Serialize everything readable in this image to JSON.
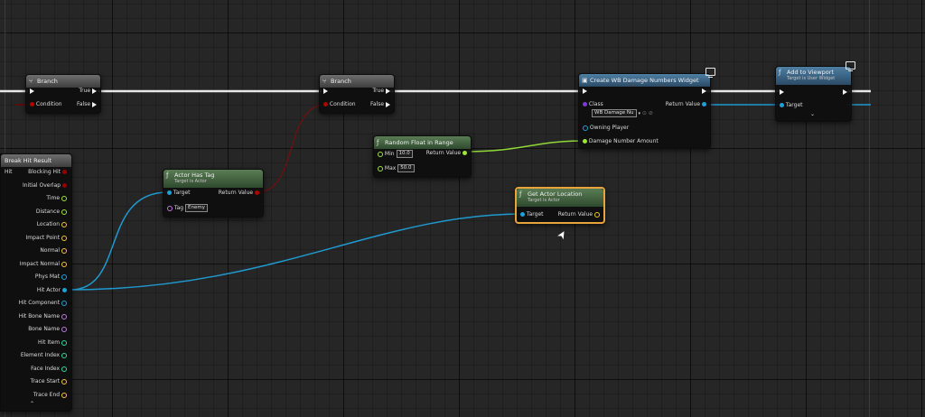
{
  "colors": {
    "exec": "#f0f0f0",
    "bool": "#930000",
    "object": "#1fa0d8",
    "float": "#9ee43c",
    "vector": "#f5c434",
    "struct": "#3a8fd0",
    "name": "#c07ad9",
    "int": "#2fd6a0",
    "selected": "#e8a33a"
  },
  "branch1": {
    "title": "Branch",
    "true_label": "True",
    "false_label": "False",
    "condition_label": "Condition"
  },
  "branch2": {
    "title": "Branch",
    "true_label": "True",
    "false_label": "False",
    "condition_label": "Condition"
  },
  "create_widget": {
    "title": "Create WB Damage Numbers Widget",
    "class_label": "Class",
    "class_value": "WB Damage Nu",
    "return_label": "Return Value",
    "owning_player_label": "Owning Player",
    "damage_amount_label": "Damage Number Amount"
  },
  "add_to_viewport": {
    "title": "Add to Viewport",
    "subtitle": "Target is User Widget",
    "target_label": "Target"
  },
  "random_float": {
    "title": "Random Float in Range",
    "min_label": "Min",
    "min_value": "10.0",
    "max_label": "Max",
    "max_value": "50.0",
    "return_label": "Return Value"
  },
  "actor_has_tag": {
    "title": "Actor Has Tag",
    "subtitle": "Target is Actor",
    "target_label": "Target",
    "return_label": "Return Value",
    "tag_label": "Tag",
    "tag_value": "Enemy"
  },
  "get_actor_location": {
    "title": "Get Actor Location",
    "subtitle": "Target is Actor",
    "target_label": "Target",
    "return_label": "Return Value"
  },
  "break_hit": {
    "title": "Break Hit Result",
    "hit_label": "Hit",
    "pins": [
      "Blocking Hit",
      "Initial Overlap",
      "Time",
      "Distance",
      "Location",
      "Impact Point",
      "Normal",
      "Impact Normal",
      "Phys Mat",
      "Hit Actor",
      "Hit Component",
      "Hit Bone Name",
      "Bone Name",
      "Hit Item",
      "Element Index",
      "Face Index",
      "Trace Start",
      "Trace End"
    ]
  }
}
